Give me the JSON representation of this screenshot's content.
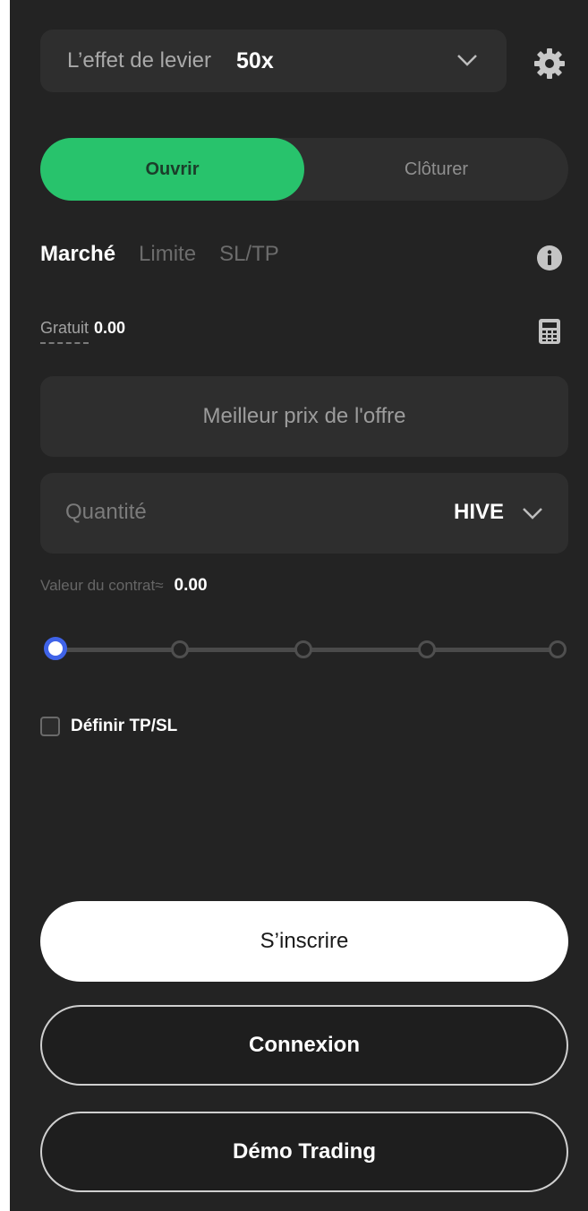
{
  "leverage": {
    "label": "L’effet de levier",
    "value": "50x"
  },
  "mode": {
    "open_label": "Ouvrir",
    "close_label": "Clôturer",
    "active": "open",
    "accent": "#28c36c"
  },
  "order_tabs": [
    {
      "label": "Marché",
      "active": true
    },
    {
      "label": "Limite",
      "active": false
    },
    {
      "label": "SL/TP",
      "active": false
    }
  ],
  "free": {
    "label": "Gratuit",
    "value": "0.00"
  },
  "price_field": {
    "placeholder": "Meilleur prix de l'offre"
  },
  "quantity_field": {
    "placeholder": "Quantité",
    "unit": "HIVE"
  },
  "contract": {
    "label": "Valeur du contrat≈",
    "value": "0.00"
  },
  "slider": {
    "value_percent": 0,
    "stops": 5,
    "thumb_color": "#3f63e8"
  },
  "tpsl": {
    "label": "Définir TP/SL",
    "checked": false
  },
  "buttons": {
    "signup": "S’inscrire",
    "login": "Connexion",
    "demo": "Démo Trading"
  },
  "icons": {
    "settings": "gear-icon",
    "info": "info-icon",
    "calculator": "calculator-icon",
    "dropdown": "chevron-down-icon"
  }
}
